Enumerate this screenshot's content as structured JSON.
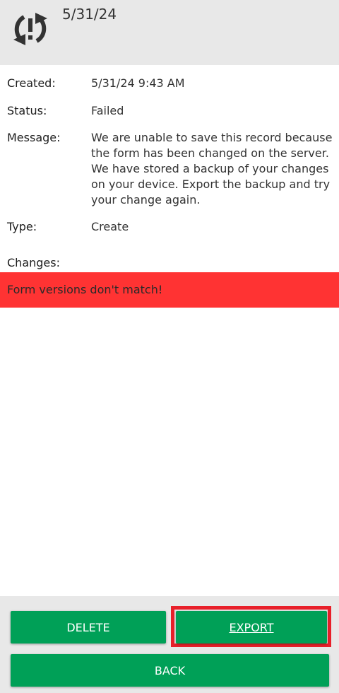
{
  "header": {
    "icon": "sync-error-icon",
    "date": "5/31/24"
  },
  "details": {
    "created_label": "Created:",
    "created_value": "5/31/24 9:43 AM",
    "status_label": "Status:",
    "status_value": "Failed",
    "message_label": "Message:",
    "message_value": "We are unable to save this record because the form has been changed on the server. We have stored a backup of your changes on your device. Export the backup and try your change again.",
    "type_label": "Type:",
    "type_value": "Create"
  },
  "changes": {
    "label": "Changes:",
    "error_text": "Form versions don't match!"
  },
  "buttons": {
    "delete_label": "DELETE",
    "export_label": "EXPORT",
    "back_label": "BACK"
  },
  "colors": {
    "header_bg": "#e8e8e8",
    "error_bg": "#ff3333",
    "button_green": "#00a057",
    "highlight_red": "#e8202a"
  }
}
